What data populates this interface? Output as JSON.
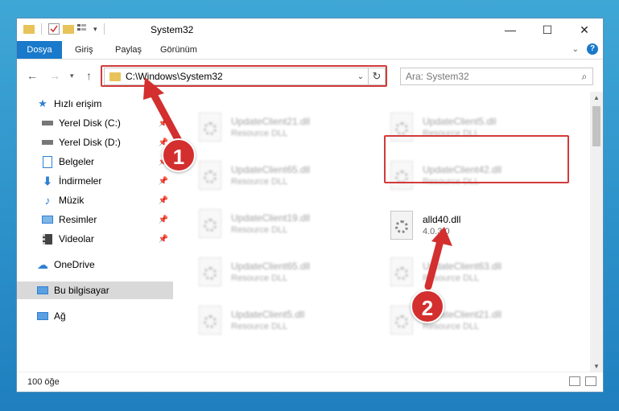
{
  "window": {
    "title": "System32",
    "controls": {
      "minimize": "—",
      "maximize": "☐",
      "close": "✕"
    }
  },
  "ribbon": {
    "tabs": [
      "Dosya",
      "Giriş",
      "Paylaş",
      "Görünüm"
    ]
  },
  "nav": {
    "address": "C:\\Windows\\System32",
    "search_placeholder": "Ara: System32"
  },
  "sidebar": {
    "items": [
      {
        "label": "Hızlı erişim",
        "icon": "star-icon"
      },
      {
        "label": "Yerel Disk (C:)",
        "icon": "drive-icon"
      },
      {
        "label": "Yerel Disk (D:)",
        "icon": "drive-icon"
      },
      {
        "label": "Belgeler",
        "icon": "documents-icon"
      },
      {
        "label": "İndirmeler",
        "icon": "download-icon"
      },
      {
        "label": "Müzik",
        "icon": "music-icon"
      },
      {
        "label": "Resimler",
        "icon": "pictures-icon"
      },
      {
        "label": "Videolar",
        "icon": "video-icon"
      },
      {
        "label": "OneDrive",
        "icon": "cloud-icon"
      },
      {
        "label": "Bu bilgisayar",
        "icon": "computer-icon"
      },
      {
        "label": "Ağ",
        "icon": "network-icon"
      }
    ],
    "selected": "Bu bilgisayar"
  },
  "files": [
    {
      "name": "UpdateClient21.dll",
      "sub": "Resource DLL"
    },
    {
      "name": "UpdateClient5.dll",
      "sub": "Resource DLL"
    },
    {
      "name": "UpdateClient65.dll",
      "sub": "Resource DLL"
    },
    {
      "name": "UpdateClient42.dll",
      "sub": "Resource DLL"
    },
    {
      "name": "UpdateClient19.dll",
      "sub": "Resource DLL"
    },
    {
      "name": "alld40.dll",
      "sub": "4.0.3.0"
    },
    {
      "name": "UpdateClient65.dll",
      "sub": "Resource DLL"
    },
    {
      "name": "UpdateClient63.dll",
      "sub": "Resource DLL"
    },
    {
      "name": "UpdateClient5.dll",
      "sub": "Resource DLL"
    },
    {
      "name": "UpdateClient21.dll",
      "sub": "Resource DLL"
    }
  ],
  "status": {
    "item_count": "100 öğe"
  },
  "callouts": {
    "one": "1",
    "two": "2"
  },
  "colors": {
    "accent": "#1979ca",
    "highlight": "#d23a3a",
    "callout": "#d32f2f"
  }
}
